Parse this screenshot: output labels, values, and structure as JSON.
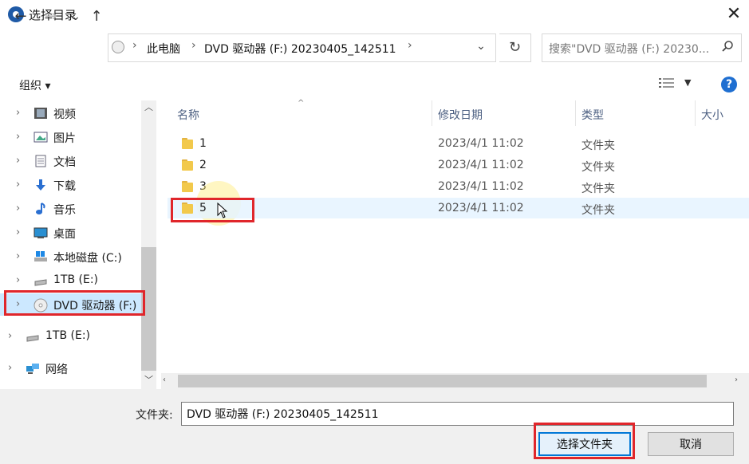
{
  "window": {
    "title": "选择目录",
    "close_label": "✕"
  },
  "nav": {
    "back": "←",
    "forward": "→",
    "recent": "⌄",
    "up": "↑",
    "refresh": "↻",
    "addr_dropdown": "⌄"
  },
  "breadcrumb": [
    "此电脑",
    "DVD 驱动器 (F:) 20230405_142511"
  ],
  "search": {
    "placeholder": "搜索\"DVD 驱动器 (F:) 20230..."
  },
  "toolbar": {
    "organize": "组织 ▾",
    "help": "?"
  },
  "sidebar": {
    "items": [
      {
        "label": "视频",
        "icon": "video-icon"
      },
      {
        "label": "图片",
        "icon": "pictures-icon"
      },
      {
        "label": "文档",
        "icon": "documents-icon"
      },
      {
        "label": "下载",
        "icon": "download-icon"
      },
      {
        "label": "音乐",
        "icon": "music-icon"
      },
      {
        "label": "桌面",
        "icon": "desktop-icon"
      },
      {
        "label": "本地磁盘 (C:)",
        "icon": "windows-drive-icon"
      },
      {
        "label": "1TB (E:)",
        "icon": "drive-icon"
      },
      {
        "label": "DVD 驱动器 (F:)",
        "icon": "dvd-icon"
      },
      {
        "label": "1TB (E:)",
        "icon": "drive-icon"
      },
      {
        "label": "网络",
        "icon": "network-icon"
      }
    ]
  },
  "columns": {
    "name": "名称",
    "modified": "修改日期",
    "type": "类型",
    "size": "大小"
  },
  "files": [
    {
      "name": "1",
      "modified": "2023/4/1 11:02",
      "type": "文件夹"
    },
    {
      "name": "2",
      "modified": "2023/4/1 11:02",
      "type": "文件夹"
    },
    {
      "name": "3",
      "modified": "2023/4/1 11:02",
      "type": "文件夹"
    },
    {
      "name": "5",
      "modified": "2023/4/1 11:02",
      "type": "文件夹"
    }
  ],
  "footer": {
    "folder_label": "文件夹:",
    "folder_value": "DVD 驱动器 (F:) 20230405_142511",
    "select_button": "选择文件夹",
    "cancel_button": "取消"
  },
  "colors": {
    "selection": "#cce8ff",
    "row_highlight": "#e5f3ff",
    "annotation_red": "#e0262b",
    "accent": "#0078d7"
  }
}
